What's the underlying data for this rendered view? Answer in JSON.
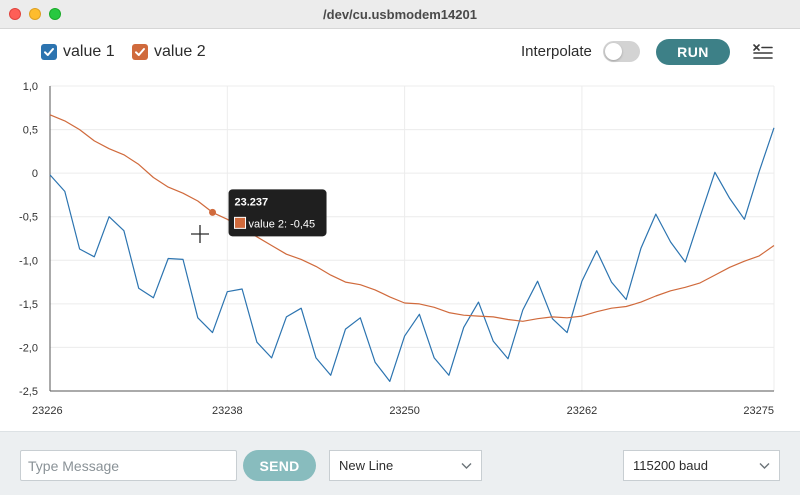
{
  "window": {
    "title": "/dev/cu.usbmodem14201"
  },
  "toolbar": {
    "legend": [
      {
        "label": "value 1",
        "checked": true,
        "color": "#2c74b0"
      },
      {
        "label": "value 2",
        "checked": true,
        "color": "#d06a3c"
      }
    ],
    "interpolate_label": "Interpolate",
    "interpolate_on": false,
    "run_label": "RUN",
    "clear_icon": "clear-output-icon"
  },
  "chart_data": {
    "type": "line",
    "x_ticks": [
      "23226",
      "23238",
      "23250",
      "23262",
      "23275"
    ],
    "y_ticks": [
      "1,0",
      "0,5",
      "0",
      "-0,5",
      "-1,0",
      "-1,5",
      "-2,0",
      "-2,5"
    ],
    "xlim": [
      23226,
      23275
    ],
    "ylim": [
      -2.5,
      1.0
    ],
    "grid": true,
    "series": [
      {
        "name": "value 1",
        "color": "#2c74b0",
        "x": [
          23226,
          23227,
          23228,
          23229,
          23230,
          23231,
          23232,
          23233,
          23234,
          23235,
          23236,
          23237,
          23238,
          23239,
          23240,
          23241,
          23242,
          23243,
          23244,
          23245,
          23246,
          23247,
          23248,
          23249,
          23250,
          23251,
          23252,
          23253,
          23254,
          23255,
          23256,
          23257,
          23258,
          23259,
          23260,
          23261,
          23262,
          23263,
          23264,
          23265,
          23266,
          23267,
          23268,
          23269,
          23270,
          23271,
          23272,
          23273,
          23274,
          23275
        ],
        "values": [
          -0.02,
          -0.21,
          -0.87,
          -0.96,
          -0.5,
          -0.66,
          -1.32,
          -1.43,
          -0.98,
          -0.99,
          -1.66,
          -1.83,
          -1.36,
          -1.33,
          -1.94,
          -2.12,
          -1.65,
          -1.55,
          -2.12,
          -2.32,
          -1.79,
          -1.66,
          -2.17,
          -2.39,
          -1.87,
          -1.62,
          -2.12,
          -2.32,
          -1.77,
          -1.48,
          -1.93,
          -2.13,
          -1.57,
          -1.24,
          -1.67,
          -1.83,
          -1.24,
          -0.89,
          -1.25,
          -1.45,
          -0.86,
          -0.47,
          -0.79,
          -1.02,
          -0.5,
          0.01,
          -0.29,
          -0.53,
          0.02,
          0.52
        ]
      },
      {
        "name": "value 2",
        "color": "#d06a3c",
        "x": [
          23226,
          23227,
          23228,
          23229,
          23230,
          23231,
          23232,
          23233,
          23234,
          23235,
          23236,
          23237,
          23238,
          23239,
          23240,
          23241,
          23242,
          23243,
          23244,
          23245,
          23246,
          23247,
          23248,
          23249,
          23250,
          23251,
          23252,
          23253,
          23254,
          23255,
          23256,
          23257,
          23258,
          23259,
          23260,
          23261,
          23262,
          23263,
          23264,
          23265,
          23266,
          23267,
          23268,
          23269,
          23270,
          23271,
          23272,
          23273,
          23274,
          23275
        ],
        "values": [
          0.67,
          0.6,
          0.5,
          0.37,
          0.28,
          0.21,
          0.1,
          -0.05,
          -0.16,
          -0.23,
          -0.32,
          -0.45,
          -0.53,
          -0.63,
          -0.73,
          -0.83,
          -0.93,
          -0.99,
          -1.07,
          -1.17,
          -1.25,
          -1.28,
          -1.34,
          -1.42,
          -1.49,
          -1.5,
          -1.54,
          -1.6,
          -1.63,
          -1.64,
          -1.65,
          -1.68,
          -1.7,
          -1.67,
          -1.65,
          -1.66,
          -1.64,
          -1.59,
          -1.55,
          -1.53,
          -1.48,
          -1.41,
          -1.35,
          -1.31,
          -1.26,
          -1.17,
          -1.08,
          -1.01,
          -0.95,
          -0.83
        ]
      }
    ],
    "tooltip": {
      "x": 23237,
      "series_index": 1,
      "title": "23.237",
      "text": "value 2: -0,45"
    }
  },
  "bottom": {
    "message_placeholder": "Type Message",
    "send_label": "SEND",
    "line_ending": "New Line",
    "baud": "115200 baud"
  }
}
